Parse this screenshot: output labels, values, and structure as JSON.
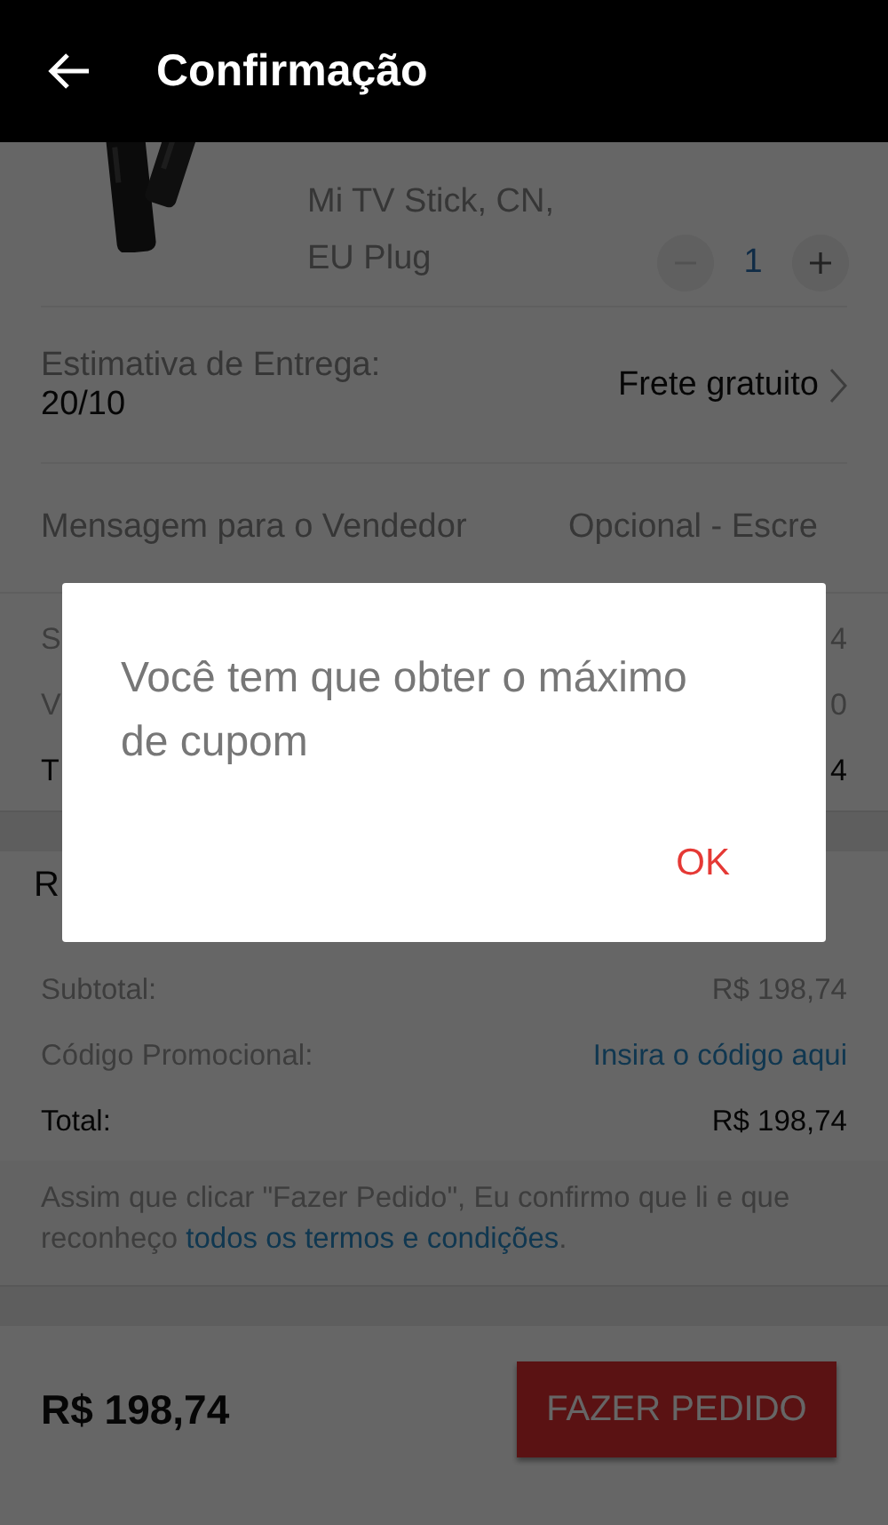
{
  "header": {
    "title": "Confirmação"
  },
  "product": {
    "kind": "picture",
    "name_lines": [
      "Mi TV Stick, CN,",
      "EU Plug"
    ],
    "quantity": "1"
  },
  "delivery": {
    "label": "Estimativa de Entrega:",
    "date": "20/10",
    "shipping": "Frete gratuito"
  },
  "message": {
    "label": "Mensagem para o Vendedor",
    "placeholder": "Opcional - Escre"
  },
  "partial_rows": [
    {
      "label": "S",
      "value": "4",
      "kind": "plain"
    },
    {
      "label": "V",
      "value": "0",
      "kind": "plain"
    },
    {
      "label": "T",
      "value": "4",
      "kind": "total"
    }
  ],
  "summary": {
    "title": "R",
    "rows": [
      {
        "label": "Subtotal:",
        "value": "R$ 198,74",
        "kind": "plain"
      },
      {
        "label": "Código Promocional:",
        "value": "Insira o código aqui",
        "kind": "link"
      },
      {
        "label": "Total:",
        "value": "R$ 198,74",
        "kind": "total"
      }
    ]
  },
  "notice": {
    "text": "Assim que clicar \"Fazer Pedido\", Eu confirmo que li e que reconheço ",
    "link": "todos os termos e condições",
    "end": "."
  },
  "footer": {
    "total": "R$ 198,74",
    "button": "FAZER PEDIDO"
  },
  "dialog": {
    "message": "Você tem que obter o máximo de cupom",
    "button": "OK"
  }
}
